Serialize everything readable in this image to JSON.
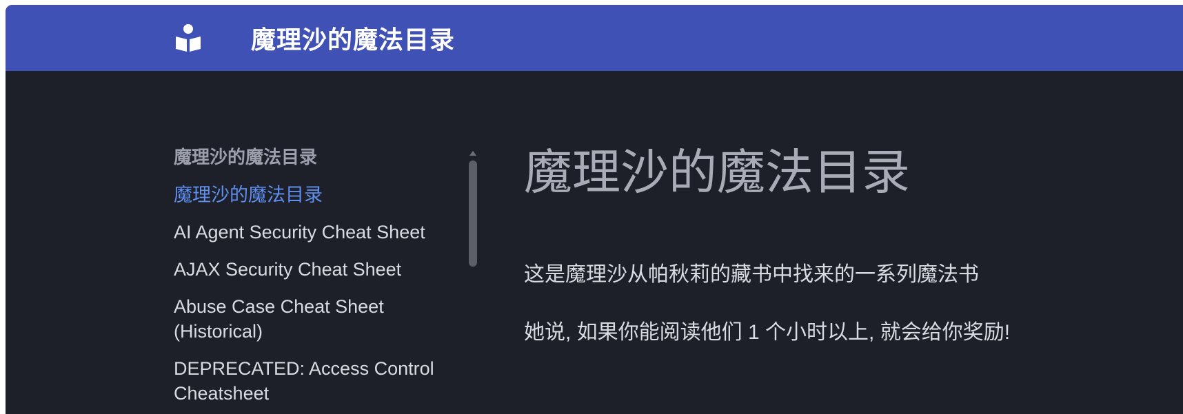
{
  "header": {
    "logo_icon": "book-reader-icon",
    "title": "魔理沙的魔法目录",
    "bg_color": "#3f51b5"
  },
  "sidebar": {
    "heading": "魔理沙的魔法目录",
    "items": [
      {
        "label": "魔理沙的魔法目录",
        "active": true
      },
      {
        "label": "AI Agent Security Cheat Sheet",
        "active": false
      },
      {
        "label": "AJAX Security Cheat Sheet",
        "active": false
      },
      {
        "label": "Abuse Case Cheat Sheet (Historical)",
        "active": false
      },
      {
        "label": "DEPRECATED: Access Control Cheatsheet",
        "active": false
      }
    ],
    "active_color": "#5f8fef"
  },
  "main": {
    "title": "魔理沙的魔法目录",
    "paragraphs": [
      "这是魔理沙从帕秋莉的藏书中找来的一系列魔法书",
      "她说, 如果你能阅读他们 1 个小时以上, 就会给你奖励!"
    ]
  },
  "theme": {
    "background": "#1e2029",
    "text": "#d9dbe3"
  }
}
